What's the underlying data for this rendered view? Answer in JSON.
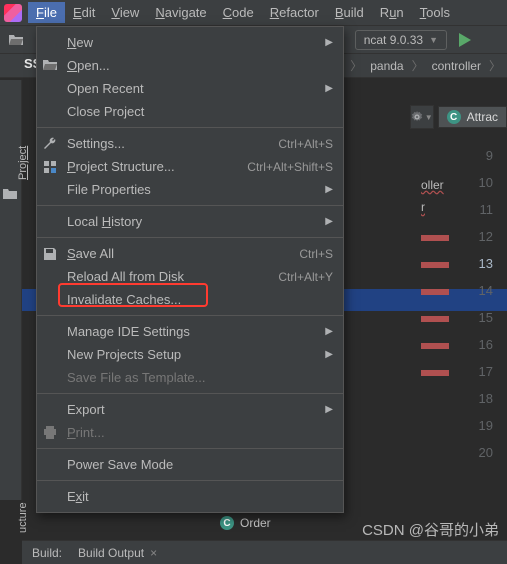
{
  "menubar": {
    "items": [
      {
        "label": "File",
        "ul": "F",
        "rest": "ile"
      },
      {
        "label": "Edit",
        "ul": "E",
        "rest": "dit"
      },
      {
        "label": "View",
        "ul": "V",
        "rest": "iew"
      },
      {
        "label": "Navigate",
        "ul": "N",
        "rest": "avigate"
      },
      {
        "label": "Code",
        "ul": "C",
        "rest": "ode"
      },
      {
        "label": "Refactor",
        "ul": "R",
        "rest": "efactor"
      },
      {
        "label": "Build",
        "ul": "B",
        "rest": "uild"
      },
      {
        "label": "Run",
        "pre": "R",
        "ul": "u",
        "rest": "n"
      },
      {
        "label": "Tools",
        "ul": "T",
        "rest": "ools"
      }
    ]
  },
  "run_config": {
    "label": "ncat 9.0.33"
  },
  "breadcrumbs": {
    "items": [
      "panda",
      "controller"
    ]
  },
  "sidebar": {
    "tab1": "Project",
    "tab2": "ucture",
    "project": "SSN"
  },
  "tab": {
    "label": "Attrac"
  },
  "gutter": {
    "start": 9,
    "end": 20,
    "current": 13
  },
  "code_hint": {
    "text1": "oller",
    "text2": "r"
  },
  "menu": {
    "groups": [
      [
        {
          "label": "New",
          "ul": "N",
          "rest": "ew",
          "submenu": true
        },
        {
          "label": "Open...",
          "ul": "O",
          "rest": "pen...",
          "icon": "open"
        },
        {
          "label": "Open Recent",
          "submenu": true
        },
        {
          "label": "Close Project"
        }
      ],
      [
        {
          "label": "Settings...",
          "icon": "gear",
          "shortcut": "Ctrl+Alt+S"
        },
        {
          "label": "Project Structure...",
          "ul": "P",
          "rest": "roject Structure...",
          "icon": "structure",
          "shortcut": "Ctrl+Alt+Shift+S"
        },
        {
          "label": "File Properties",
          "submenu": true
        }
      ],
      [
        {
          "label": "Local History",
          "ul": "H",
          "pre": "Local ",
          "rest": "istory",
          "submenu": true
        }
      ],
      [
        {
          "label": "Save All",
          "ul": "S",
          "rest": "ave All",
          "icon": "save",
          "shortcut": "Ctrl+S"
        },
        {
          "label": "Reload All from Disk",
          "shortcut": "Ctrl+Alt+Y"
        },
        {
          "label": "Invalidate Caches..."
        }
      ],
      [
        {
          "label": "Manage IDE Settings",
          "submenu": true
        },
        {
          "label": "New Projects Setup",
          "submenu": true
        },
        {
          "label": "Save File as Template...",
          "disabled": true
        }
      ],
      [
        {
          "label": "Export",
          "submenu": true
        },
        {
          "label": "Print...",
          "ul": "P",
          "rest": "rint...",
          "icon": "print",
          "disabled": true
        }
      ],
      [
        {
          "label": "Power Save Mode"
        }
      ],
      [
        {
          "label": "Exit",
          "pre": "E",
          "ul": "x",
          "rest": "it"
        }
      ]
    ]
  },
  "order_tag": "Order",
  "build_bar": {
    "label1": "Build:",
    "label2": "Build Output"
  },
  "watermark": "CSDN @谷哥的小弟"
}
